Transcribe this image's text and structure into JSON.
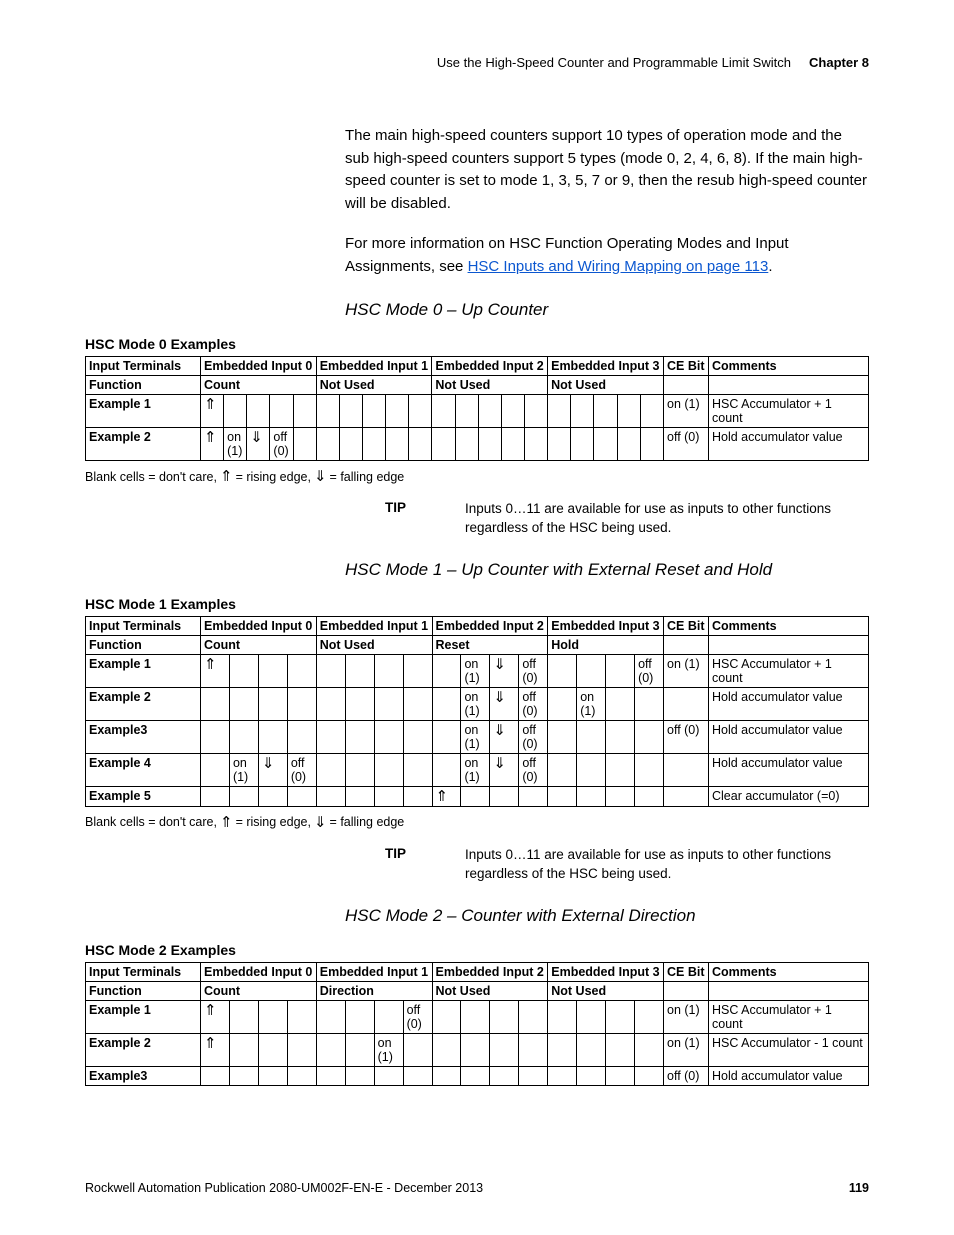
{
  "headerLeft": "Use the High-Speed Counter and Programmable Limit Switch",
  "headerRight": "Chapter 8",
  "para1": "The main high-speed counters support 10 types of operation mode and the sub high-speed counters support 5 types (mode 0, 2, 4, 6, 8). If the main high-speed counter is set to mode 1, 3, 5, 7 or 9, then the resub high-speed counter will be disabled.",
  "para2a": "For more information on HSC Function Operating Modes and Input Assignments, see ",
  "para2link": "HSC Inputs and Wiring Mapping on page 113",
  "para2b": ".",
  "mode0Title": "HSC Mode 0 – Up Counter",
  "mode0Caption": "HSC Mode 0 Examples",
  "mode1Title": "HSC Mode 1 – Up Counter with External Reset and Hold",
  "mode1Caption": "HSC Mode 1 Examples",
  "mode2Title": "HSC Mode 2 – Counter with External Direction",
  "mode2Caption": "HSC Mode 2 Examples",
  "legendPrefix": "Blank cells = don't care, ",
  "legendMid": "= rising edge, ",
  "legendSuffix": " = falling edge",
  "tipLabel": "TIP",
  "tipText": "Inputs 0…11 are available for use as inputs to other functions regardless of the HSC being used.",
  "thInputTerminals": "Input Terminals",
  "thFunction": "Function",
  "thEmbedded0": "Embedded Input 0",
  "thEmb1": "Embedded Input 1",
  "thEmb2": "Embedded Input 2",
  "thEmb3": "Embedded Input 3",
  "thCE": "CE Bit",
  "thComments": "Comments",
  "fnCount": "Count",
  "fnNotUsed": "Not Used",
  "fnReset": "Reset",
  "fnHold": "Hold",
  "fnDirection": "Direction",
  "ex1": "Example 1",
  "ex2": "Example 2",
  "ex3": "Example3",
  "ex3s": "Example 3",
  "ex4": "Example 4",
  "ex5": "Example 5",
  "onTxt": "on (1)",
  "offTxt": "off (0)",
  "onBr": "on (1)",
  "offBr": "off (0)",
  "cAccPlus1": "HSC Accumulator + 1 count",
  "cAccMinus1": "HSC Accumulator - 1 count",
  "cHold": "Hold accumulator value",
  "cClear": "Clear accumulator (=0)",
  "footerPub": "Rockwell Automation Publication 2080-UM002F-EN-E - December 2013",
  "pageNum": "119"
}
